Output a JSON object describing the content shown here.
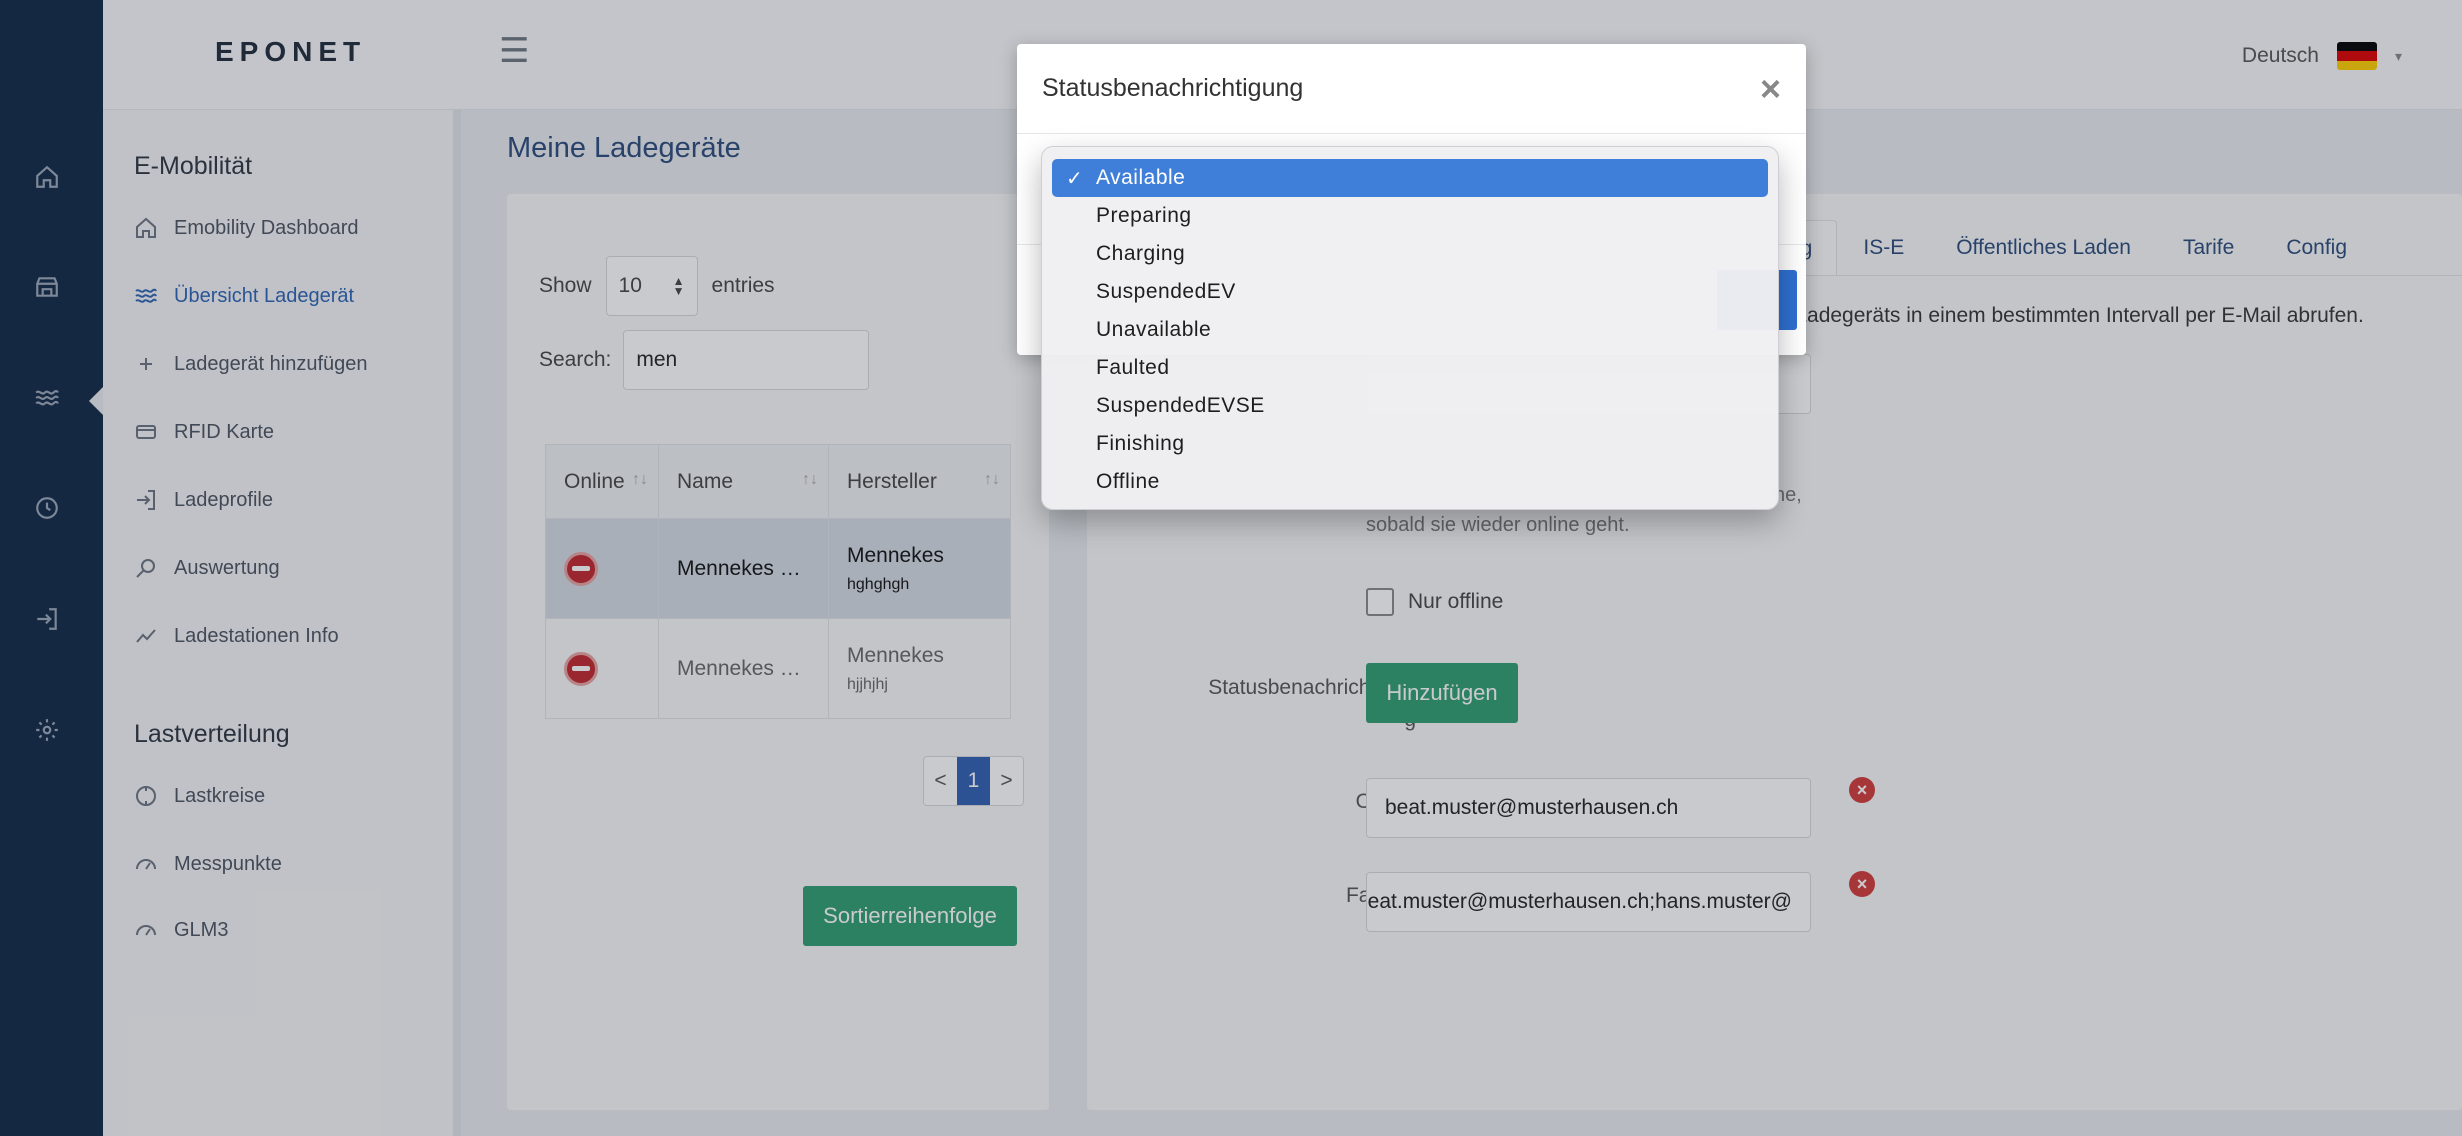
{
  "header": {
    "logo": "EPONET",
    "menu_icon": "hamburger-icon",
    "language": "Deutsch",
    "flag_colors": [
      "#000000",
      "#dd0000",
      "#ffce00"
    ]
  },
  "rail": {
    "icons": [
      "home-icon",
      "store-icon",
      "waves-icon",
      "clock-icon",
      "login-icon",
      "gear-icon"
    ]
  },
  "sidebar": {
    "section1": "E-Mobilität",
    "items1": [
      {
        "label": "Emobility Dashboard",
        "icon": "home-icon"
      },
      {
        "label": "Übersicht Ladegerät",
        "icon": "waves-icon"
      },
      {
        "label": "Ladegerät hinzufügen",
        "icon": "plus-icon"
      },
      {
        "label": "RFID Karte",
        "icon": "card-icon"
      },
      {
        "label": "Ladeprofile",
        "icon": "login-icon"
      },
      {
        "label": "Auswertung",
        "icon": "search-icon"
      },
      {
        "label": "Ladestationen Info",
        "icon": "chart-icon"
      }
    ],
    "section2": "Lastverteilung",
    "items2": [
      {
        "label": "Lastkreise",
        "icon": "circle-icon"
      },
      {
        "label": "Messpunkte",
        "icon": "gauge-icon"
      },
      {
        "label": "GLM3",
        "icon": "gauge-icon"
      }
    ]
  },
  "main": {
    "title": "Meine Ladegeräte",
    "show_label": "Show",
    "entries_value": "10",
    "entries_label": "entries",
    "search_label": "Search:",
    "search_value": "men",
    "table": {
      "headers": [
        "Online",
        "Name",
        "Hersteller"
      ],
      "rows": [
        {
          "name": "Mennekes …",
          "vendor": "Mennekes",
          "serial": "hghghgh"
        },
        {
          "name": "Mennekes …",
          "vendor": "Mennekes",
          "serial": "hjjhjhj"
        }
      ]
    },
    "pager": {
      "prev": "<",
      "current": "1",
      "next": ">"
    },
    "sort_button": "Sortierreihenfolge"
  },
  "detail": {
    "tabs": [
      "ng",
      "IS-E",
      "Öffentliches Laden",
      "Tarife",
      "Config"
    ],
    "description": "s Ladegeräts in einem bestimmten Intervall per E-Mail abrufen.",
    "info_line1": "ne,",
    "info_line2": "sobald sie wieder online geht.",
    "checkbox_label": "Nur offline",
    "status_label_a": "Statusbenachrichtigun",
    "status_label_b": "g",
    "add_button": "Hinzufügen",
    "notifications": [
      {
        "label": "Offline",
        "value": "beat.muster@musterhausen.ch"
      },
      {
        "label": "Faulted",
        "value": "beat.muster@musterhausen.ch;hans.muster@"
      }
    ]
  },
  "modal": {
    "title": "Statusbenachrichtigung",
    "close": "×",
    "options": [
      "Available",
      "Preparing",
      "Charging",
      "SuspendedEV",
      "Unavailable",
      "Faulted",
      "SuspendedEVSE",
      "Finishing",
      "Offline"
    ],
    "selected": "Available",
    "check": "✓"
  }
}
